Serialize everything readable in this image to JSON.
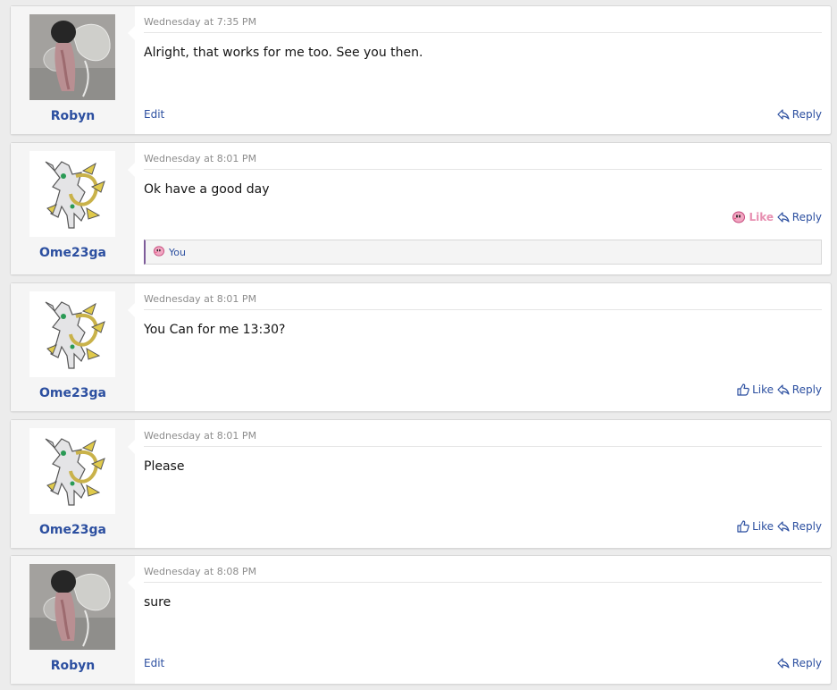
{
  "posts": [
    {
      "username": "Robyn",
      "date": "Wednesday at 7:35 PM",
      "message": "Alright, that works for me too. See you then.",
      "edit_label": "Edit",
      "reply_label": "Reply"
    },
    {
      "username": "Ome23ga",
      "date": "Wednesday at 8:01 PM",
      "message": "Ok have a good day",
      "like_label": "Like",
      "reply_label": "Reply",
      "likes_text": "You"
    },
    {
      "username": "Ome23ga",
      "date": "Wednesday at 8:01 PM",
      "message": "You Can for me 13:30?",
      "like_label": "Like",
      "reply_label": "Reply"
    },
    {
      "username": "Ome23ga",
      "date": "Wednesday at 8:01 PM",
      "message": "Please",
      "like_label": "Like",
      "reply_label": "Reply"
    },
    {
      "username": "Robyn",
      "date": "Wednesday at 8:08 PM",
      "message": "sure",
      "edit_label": "Edit",
      "reply_label": "Reply"
    }
  ],
  "colors": {
    "link": "#2c4fa0",
    "liked": "#e78fb1",
    "like_bar_accent": "#7e5c9a"
  }
}
